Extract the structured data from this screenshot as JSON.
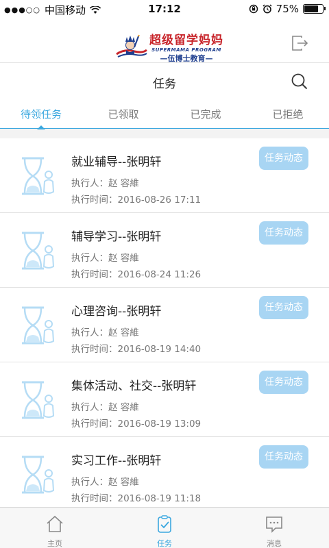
{
  "status_bar": {
    "carrier": "中国移动",
    "time": "17:12",
    "battery_text": "75%",
    "battery_level": 0.75
  },
  "brand": {
    "logo_main": "超级留学妈妈",
    "logo_en": "SUPERMAMA PROGRAM",
    "logo_sub": "—伍博士教育—",
    "logout_icon": "logout-icon"
  },
  "header": {
    "title": "任务",
    "search_icon": "search-icon"
  },
  "tabs": [
    {
      "label": "待领任务",
      "active": true
    },
    {
      "label": "已领取",
      "active": false
    },
    {
      "label": "已完成",
      "active": false
    },
    {
      "label": "已拒绝",
      "active": false
    }
  ],
  "tasks": [
    {
      "title": "就业辅导--张明轩",
      "executor": "执行人：赵 容維",
      "time": "执行时间：2016-08-26 17:11",
      "button": "任务动态"
    },
    {
      "title": "辅导学习--张明轩",
      "executor": "执行人：赵 容維",
      "time": "执行时间：2016-08-24 11:26",
      "button": "任务动态"
    },
    {
      "title": "心理咨询--张明轩",
      "executor": "执行人：赵 容維",
      "time": "执行时间：2016-08-19 14:40",
      "button": "任务动态"
    },
    {
      "title": "集体活动、社交--张明轩",
      "executor": "执行人：赵 容維",
      "time": "执行时间：2016-08-19 13:09",
      "button": "任务动态"
    },
    {
      "title": "实习工作--张明轩",
      "executor": "执行人：赵 容維",
      "time": "执行时间：2016-08-19 11:18",
      "button": "任务动态"
    }
  ],
  "bottom_nav": [
    {
      "label": "主页",
      "icon": "home-icon",
      "active": false
    },
    {
      "label": "任务",
      "icon": "clipboard-check-icon",
      "active": true
    },
    {
      "label": "消息",
      "icon": "message-icon",
      "active": false
    }
  ],
  "colors": {
    "accent": "#3aa7df",
    "button_bg": "#a8d5f3",
    "brand_red": "#c8252b",
    "brand_blue": "#1f3f8f"
  }
}
